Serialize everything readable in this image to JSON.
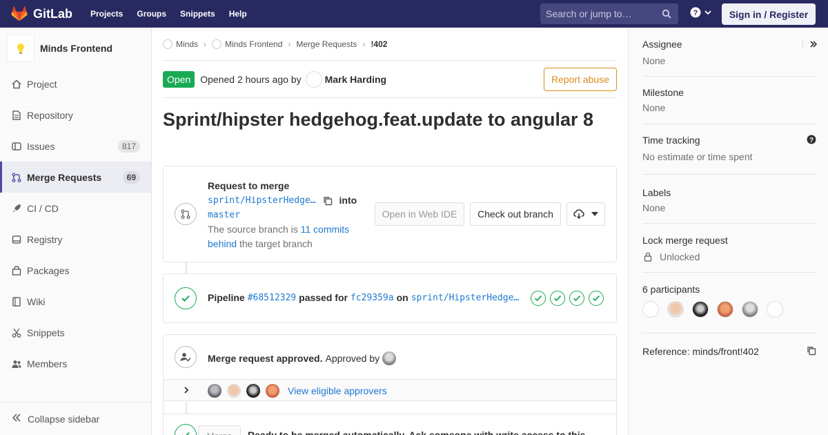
{
  "navbar": {
    "brand": "GitLab",
    "links": [
      "Projects",
      "Groups",
      "Snippets",
      "Help"
    ],
    "search_placeholder": "Search or jump to…",
    "sign_in": "Sign in / Register"
  },
  "sidebar": {
    "project_name": "Minds Frontend",
    "items": [
      {
        "label": "Project",
        "icon": "home-icon"
      },
      {
        "label": "Repository",
        "icon": "doc-icon"
      },
      {
        "label": "Issues",
        "icon": "issues-icon",
        "badge": "817"
      },
      {
        "label": "Merge Requests",
        "icon": "merge-request-icon",
        "badge": "69",
        "active": true
      },
      {
        "label": "CI / CD",
        "icon": "rocket-icon"
      },
      {
        "label": "Registry",
        "icon": "disk-icon"
      },
      {
        "label": "Packages",
        "icon": "package-icon"
      },
      {
        "label": "Wiki",
        "icon": "book-icon"
      },
      {
        "label": "Snippets",
        "icon": "scissors-icon"
      },
      {
        "label": "Members",
        "icon": "users-icon"
      }
    ],
    "collapse_label": "Collapse sidebar"
  },
  "breadcrumb": {
    "items": [
      "Minds",
      "Minds Frontend",
      "Merge Requests",
      "!402"
    ]
  },
  "mr": {
    "state": "Open",
    "opened_text": "Opened 2 hours ago by",
    "author": "Mark Harding",
    "report": "Report abuse",
    "title": "Sprint/hipster hedgehog.feat.update to angular 8"
  },
  "merge_widget": {
    "heading": "Request to merge",
    "source_branch": "sprint/HipsterHedge…",
    "into": "into",
    "target_branch": "master",
    "behind_prefix": "The source branch is",
    "behind_link": "11 commits behind",
    "behind_suffix": "the target branch",
    "web_ide": "Open in Web IDE",
    "checkout": "Check out branch"
  },
  "pipeline": {
    "label": "Pipeline",
    "id": "#68512329",
    "passed_for": "passed for",
    "commit": "fc29359a",
    "on": "on",
    "branch": "sprint/HipsterHedge…",
    "stages": 4
  },
  "approval": {
    "status": "Merge request approved.",
    "approved_by": "Approved by",
    "view_link": "View eligible approvers"
  },
  "ready": {
    "merge_btn": "Merge",
    "text": "Ready to be merged automatically. Ask someone with write access to this"
  },
  "right": {
    "assignee_title": "Assignee",
    "assignee_value": "None",
    "milestone_title": "Milestone",
    "milestone_value": "None",
    "time_title": "Time tracking",
    "time_value": "No estimate or time spent",
    "labels_title": "Labels",
    "labels_value": "None",
    "lock_title": "Lock merge request",
    "lock_value": "Unlocked",
    "participants_title": "6 participants",
    "reference": "Reference: minds/front!402"
  },
  "colors": {
    "navbar": "#292961",
    "success": "#1aaa55",
    "link": "#1f78d1",
    "warning": "#db8d1f"
  }
}
